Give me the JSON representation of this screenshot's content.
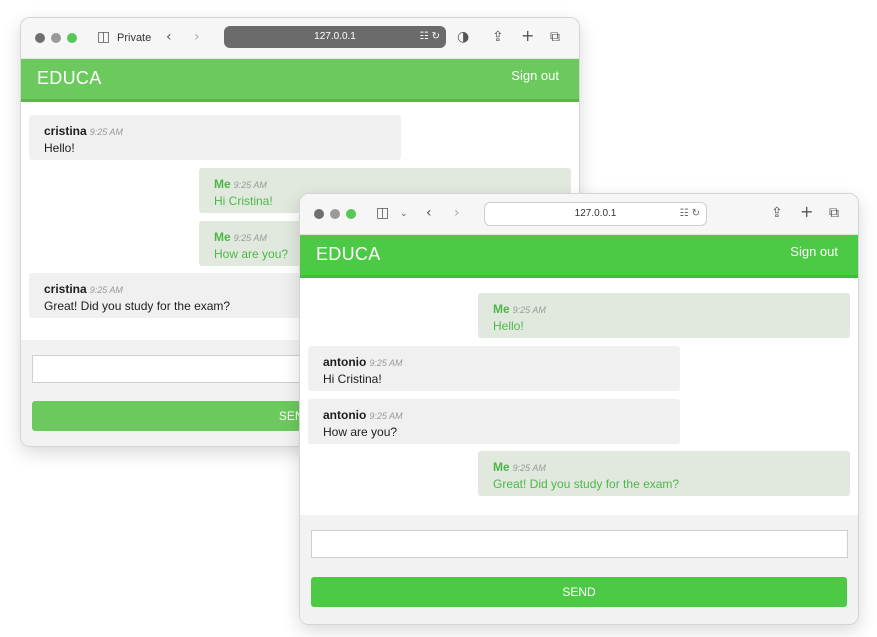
{
  "back_window": {
    "tab_label": "Private",
    "url": "127.0.0.1",
    "brand": "EDUCA",
    "signout": "Sign out",
    "send_label": "SEND",
    "messages": [
      {
        "author": "cristina",
        "time": "9:25 AM",
        "text": "Hello!",
        "kind": "other"
      },
      {
        "author": "Me",
        "time": "9:25 AM",
        "text": "Hi Cristina!",
        "kind": "me"
      },
      {
        "author": "Me",
        "time": "9:25 AM",
        "text": "How are you?",
        "kind": "me"
      },
      {
        "author": "cristina",
        "time": "9:25 AM",
        "text": "Great! Did you study for the exam?",
        "kind": "other"
      }
    ]
  },
  "front_window": {
    "url": "127.0.0.1",
    "brand": "EDUCA",
    "signout": "Sign out",
    "send_label": "SEND",
    "messages": [
      {
        "author": "Me",
        "time": "9:25 AM",
        "text": "Hello!",
        "kind": "me"
      },
      {
        "author": "antonio",
        "time": "9:25 AM",
        "text": "Hi Cristina!",
        "kind": "other"
      },
      {
        "author": "antonio",
        "time": "9:25 AM",
        "text": "How are you?",
        "kind": "other"
      },
      {
        "author": "Me",
        "time": "9:25 AM",
        "text": "Great! Did you study for the exam?",
        "kind": "me"
      }
    ]
  },
  "colors": {
    "appbar_green": "#4cca45",
    "me_bubble": "#e1e9df",
    "other_bubble": "#f0f0f0"
  },
  "icons": [
    "sidebar-icon",
    "back-icon",
    "forward-icon",
    "translate-icon",
    "reload-icon",
    "shield-icon",
    "share-icon",
    "new-tab-icon",
    "tabs-overview-icon"
  ]
}
